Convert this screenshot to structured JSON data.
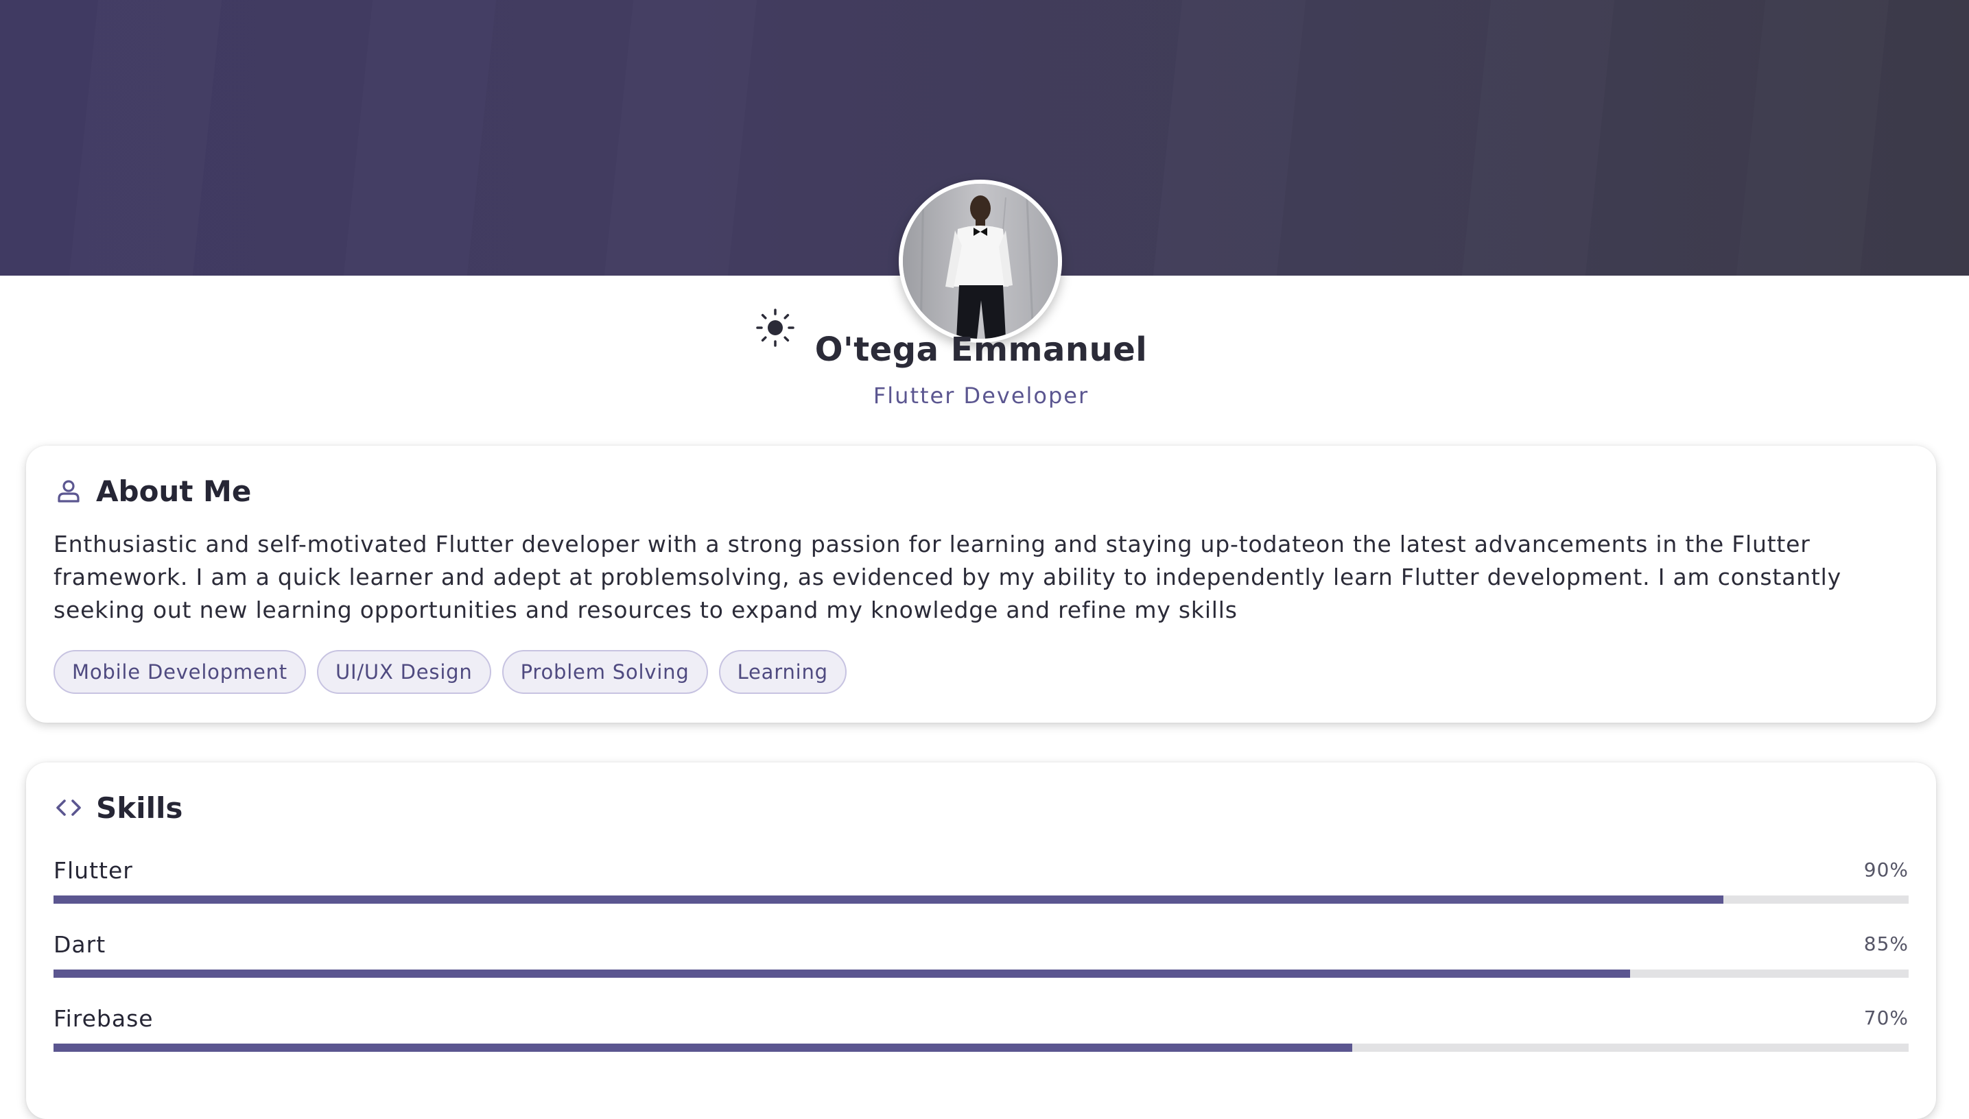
{
  "profile": {
    "name": "O'tega Emmanuel",
    "role": "Flutter Developer",
    "avatar_alt": "Profile photo"
  },
  "header": {
    "theme_toggle_icon": "sun-icon"
  },
  "about": {
    "title": "About Me",
    "icon": "person-icon",
    "text": "Enthusiastic and self-motivated Flutter developer with a strong passion for learning and staying up-todateon the latest advancements in the Flutter framework. I am a quick learner and adept at problemsolving, as evidenced by my ability to independently learn Flutter development. I am constantly seeking out new learning opportunities and resources to expand my knowledge and refine my skills",
    "tags": [
      "Mobile Development",
      "UI/UX Design",
      "Problem Solving",
      "Learning"
    ]
  },
  "skills": {
    "title": "Skills",
    "icon": "code-icon",
    "items": [
      {
        "name": "Flutter",
        "percent_label": "90%",
        "level": 0.9
      },
      {
        "name": "Dart",
        "percent_label": "85%",
        "level": 0.85
      },
      {
        "name": "Firebase",
        "percent_label": "70%",
        "level": 0.7
      }
    ]
  },
  "colors": {
    "accent": "#5b5690",
    "banner": "#403a62",
    "track": "#e2e2e4",
    "tag_bg": "#efeef6"
  }
}
